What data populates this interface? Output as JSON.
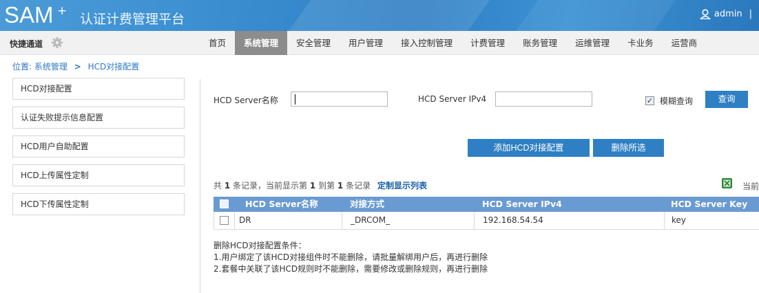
{
  "header": {
    "brand": "SAM",
    "brand_sup": "+",
    "subtitle": "认证计费管理平台",
    "user": "admin",
    "separator": "|"
  },
  "navbar": {
    "quick_label": "快捷通道",
    "menu": [
      "首页",
      "系统管理",
      "安全管理",
      "用户管理",
      "接入控制管理",
      "计费管理",
      "账务管理",
      "运维管理",
      "卡业务",
      "运营商"
    ],
    "active_index": 1
  },
  "breadcrumb": {
    "prefix": "位置:",
    "section": "系统管理",
    "page": "HCD对接配置"
  },
  "sidebar": {
    "items": [
      "HCD对接配置",
      "认证失败提示信息配置",
      "HCD用户自助配置",
      "HCD上传属性定制",
      "HCD下传属性定制"
    ]
  },
  "search": {
    "name_label": "HCD Server名称",
    "name_value": "",
    "ip_label": "HCD Server IPv4",
    "ip_value": "",
    "fuzzy_label": "模糊查询",
    "fuzzy_checked": true,
    "query_button": "查询"
  },
  "actions": {
    "add_button": "添加HCD对接配置",
    "delete_button": "删除所选"
  },
  "stats": {
    "p1": "共",
    "total": "1",
    "p2": "条记录，当前显示第",
    "from": "1",
    "p3": "到第",
    "to": "1",
    "p4": "条记录",
    "customize": "定制显示列表",
    "page_prefix": "当前"
  },
  "table": {
    "columns": [
      "HCD Server名称",
      "对接方式",
      "HCD Server IPv4",
      "HCD Server Key"
    ],
    "rows": [
      {
        "name": "DR",
        "mode": "_DRCOM_",
        "ip": "192.168.54.54",
        "key": "key"
      }
    ]
  },
  "notes": {
    "title": "删除HCD对接配置条件：",
    "lines": [
      "1.用户绑定了该HCD对接组件时不能删除，请批量解绑用户后，再进行删除",
      "2.套餐中关联了该HCD规则时不能删除，需要修改或删除规则，再进行删除"
    ]
  },
  "colors": {
    "header_blue": "#3a8ed0",
    "active_menu": "#8c8c8c",
    "button_blue": "#2f7fc4",
    "table_header": "#6a9ad2",
    "link_blue": "#2f77c7"
  }
}
